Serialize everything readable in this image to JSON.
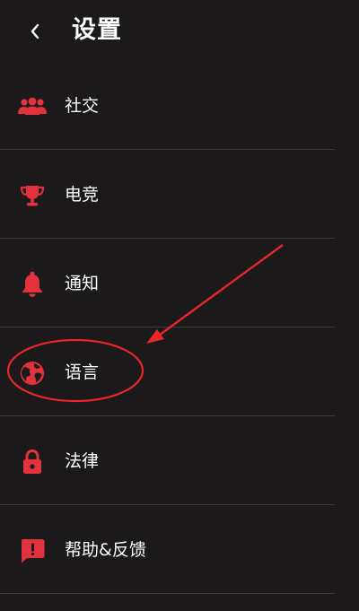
{
  "header": {
    "title": "设置"
  },
  "colors": {
    "accent": "#e2333c",
    "background": "#1b1919",
    "divider": "#3b3939",
    "annotation": "#e8262b"
  },
  "menu": {
    "items": [
      {
        "label": "社交",
        "icon": "people-icon"
      },
      {
        "label": "电竞",
        "icon": "trophy-icon"
      },
      {
        "label": "通知",
        "icon": "bell-icon"
      },
      {
        "label": "语言",
        "icon": "globe-icon"
      },
      {
        "label": "法律",
        "icon": "lock-icon"
      },
      {
        "label": "帮助&反馈",
        "icon": "feedback-icon"
      }
    ]
  }
}
